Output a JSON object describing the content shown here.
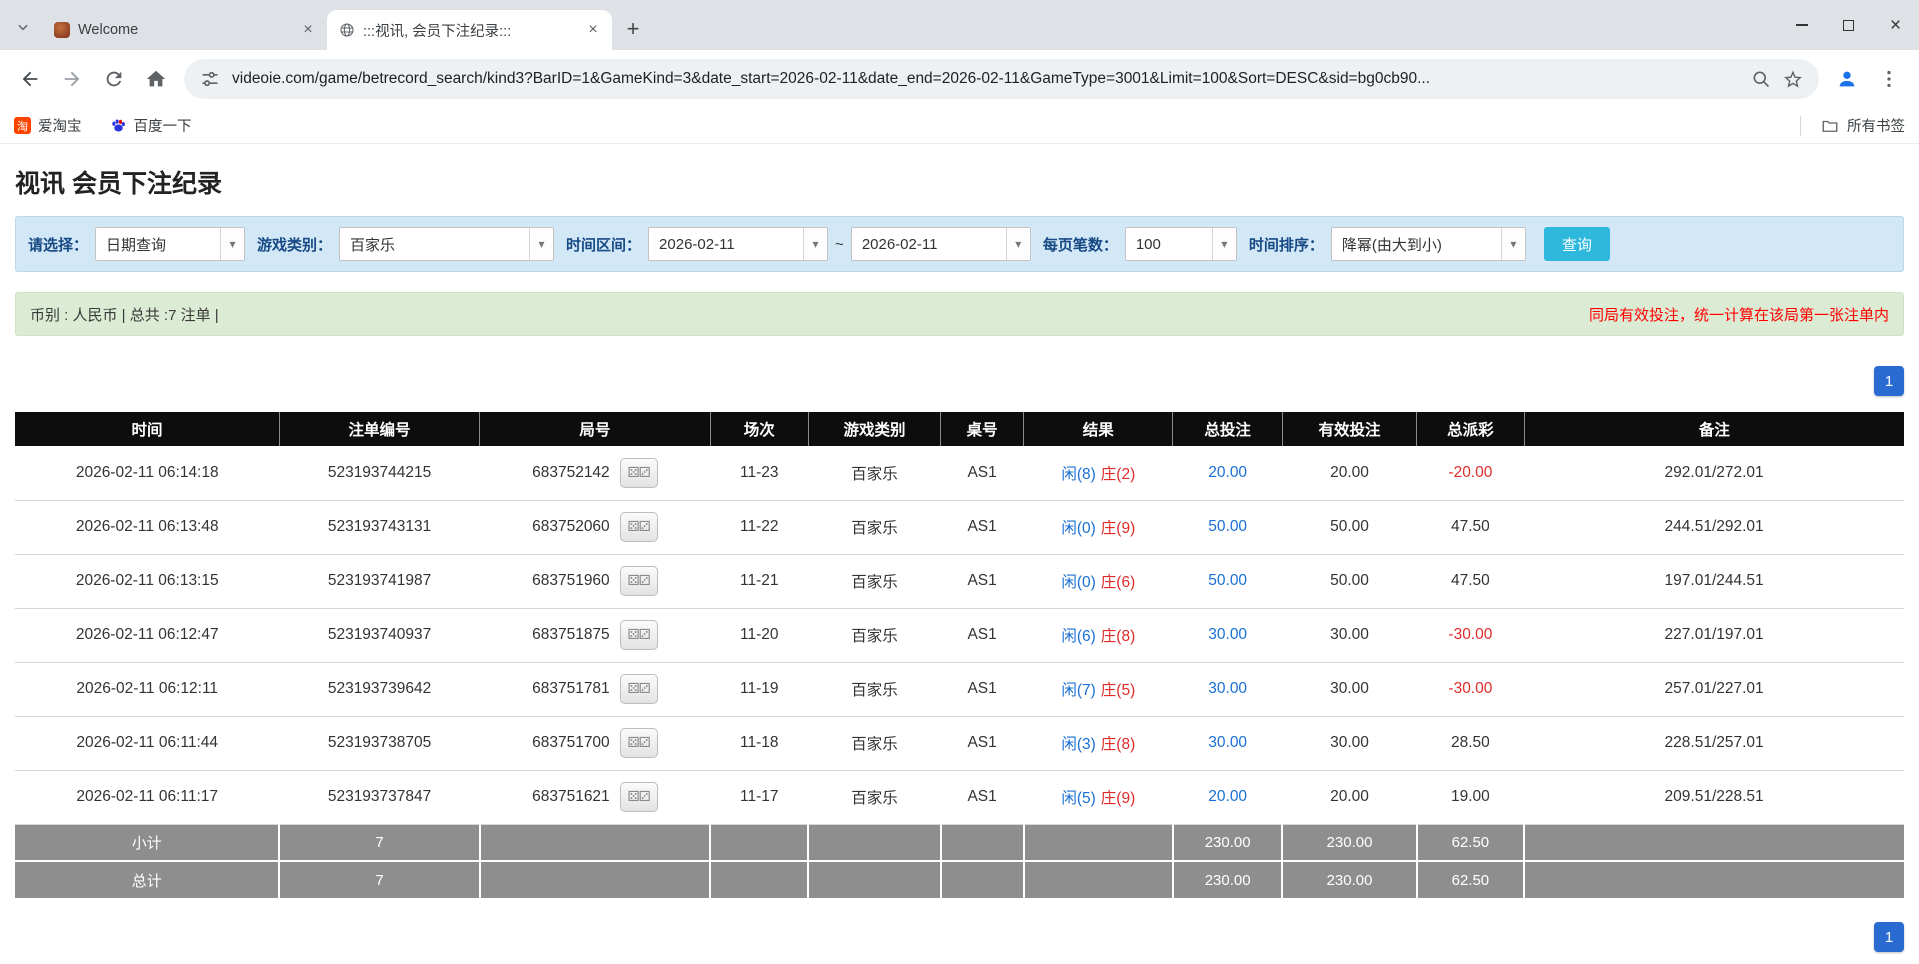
{
  "browser": {
    "tabs": [
      {
        "title": "Welcome"
      },
      {
        "title": ":::视讯, 会员下注纪录:::"
      }
    ],
    "url": "videoie.com/game/betrecord_search/kind3?BarID=1&GameKind=3&date_start=2026-02-11&date_end=2026-02-11&GameType=3001&Limit=100&Sort=DESC&sid=bg0cb90...",
    "bookmarks": [
      {
        "label": "爱淘宝"
      },
      {
        "label": "百度一下"
      }
    ],
    "all_bookmarks_label": "所有书签"
  },
  "page": {
    "title": "视讯 会员下注纪录",
    "filters": {
      "select_label": "请选择：",
      "select_value": "日期查询",
      "game_label": "游戏类别：",
      "game_value": "百家乐",
      "range_label": "时间区间：",
      "date_start": "2026-02-11",
      "range_sep": "~",
      "date_end": "2026-02-11",
      "per_page_label": "每页笔数：",
      "per_page_value": "100",
      "sort_label": "时间排序：",
      "sort_value": "降幂(由大到小)",
      "search_label": "查询"
    },
    "summary_left": "币别 : 人民币 | 总共 :7 注单 |",
    "summary_right": "同局有效投注，统一计算在该局第一张注单内",
    "pagination_label": "1",
    "table": {
      "headers": [
        "时间",
        "注单编号",
        "局号",
        "场次",
        "游戏类别",
        "桌号",
        "结果",
        "总投注",
        "有效投注",
        "总派彩",
        "备注"
      ],
      "rows": [
        {
          "time": "2026-02-11 06:14:18",
          "bet_id": "523193744215",
          "round": "683752142",
          "session": "11-23",
          "game": "百家乐",
          "table_no": "AS1",
          "result_player": "闲(8)",
          "result_banker": "庄(2)",
          "total_bet": "20.00",
          "valid_bet": "20.00",
          "payout": "-20.00",
          "note": "292.01/272.01"
        },
        {
          "time": "2026-02-11 06:13:48",
          "bet_id": "523193743131",
          "round": "683752060",
          "session": "11-22",
          "game": "百家乐",
          "table_no": "AS1",
          "result_player": "闲(0)",
          "result_banker": "庄(9)",
          "total_bet": "50.00",
          "valid_bet": "50.00",
          "payout": "47.50",
          "note": "244.51/292.01"
        },
        {
          "time": "2026-02-11 06:13:15",
          "bet_id": "523193741987",
          "round": "683751960",
          "session": "11-21",
          "game": "百家乐",
          "table_no": "AS1",
          "result_player": "闲(0)",
          "result_banker": "庄(6)",
          "total_bet": "50.00",
          "valid_bet": "50.00",
          "payout": "47.50",
          "note": "197.01/244.51"
        },
        {
          "time": "2026-02-11 06:12:47",
          "bet_id": "523193740937",
          "round": "683751875",
          "session": "11-20",
          "game": "百家乐",
          "table_no": "AS1",
          "result_player": "闲(6)",
          "result_banker": "庄(8)",
          "total_bet": "30.00",
          "valid_bet": "30.00",
          "payout": "-30.00",
          "note": "227.01/197.01"
        },
        {
          "time": "2026-02-11 06:12:11",
          "bet_id": "523193739642",
          "round": "683751781",
          "session": "11-19",
          "game": "百家乐",
          "table_no": "AS1",
          "result_player": "闲(7)",
          "result_banker": "庄(5)",
          "total_bet": "30.00",
          "valid_bet": "30.00",
          "payout": "-30.00",
          "note": "257.01/227.01"
        },
        {
          "time": "2026-02-11 06:11:44",
          "bet_id": "523193738705",
          "round": "683751700",
          "session": "11-18",
          "game": "百家乐",
          "table_no": "AS1",
          "result_player": "闲(3)",
          "result_banker": "庄(8)",
          "total_bet": "30.00",
          "valid_bet": "30.00",
          "payout": "28.50",
          "note": "228.51/257.01"
        },
        {
          "time": "2026-02-11 06:11:17",
          "bet_id": "523193737847",
          "round": "683751621",
          "session": "11-17",
          "game": "百家乐",
          "table_no": "AS1",
          "result_player": "闲(5)",
          "result_banker": "庄(9)",
          "total_bet": "20.00",
          "valid_bet": "20.00",
          "payout": "19.00",
          "note": "209.51/228.51"
        }
      ],
      "subtotal": {
        "label": "小计",
        "count": "7",
        "total_bet": "230.00",
        "valid_bet": "230.00",
        "payout": "62.50"
      },
      "total": {
        "label": "总计",
        "count": "7",
        "total_bet": "230.00",
        "valid_bet": "230.00",
        "payout": "62.50"
      }
    },
    "colors": {
      "accent_blue": "#1a6fd4",
      "negative_red": "#e02b2b",
      "search_button_bg": "#2eb8dd",
      "pager_bg": "#2a6bd2",
      "filter_label": "#174a85",
      "filter_bar_bg": "#d3e8f6",
      "summary_bar_bg": "#dcebd3",
      "summary_warning": "#ff0000",
      "table_header_bg": "#0d0d0d",
      "table_footer_bg": "#8e8e8e"
    }
  }
}
